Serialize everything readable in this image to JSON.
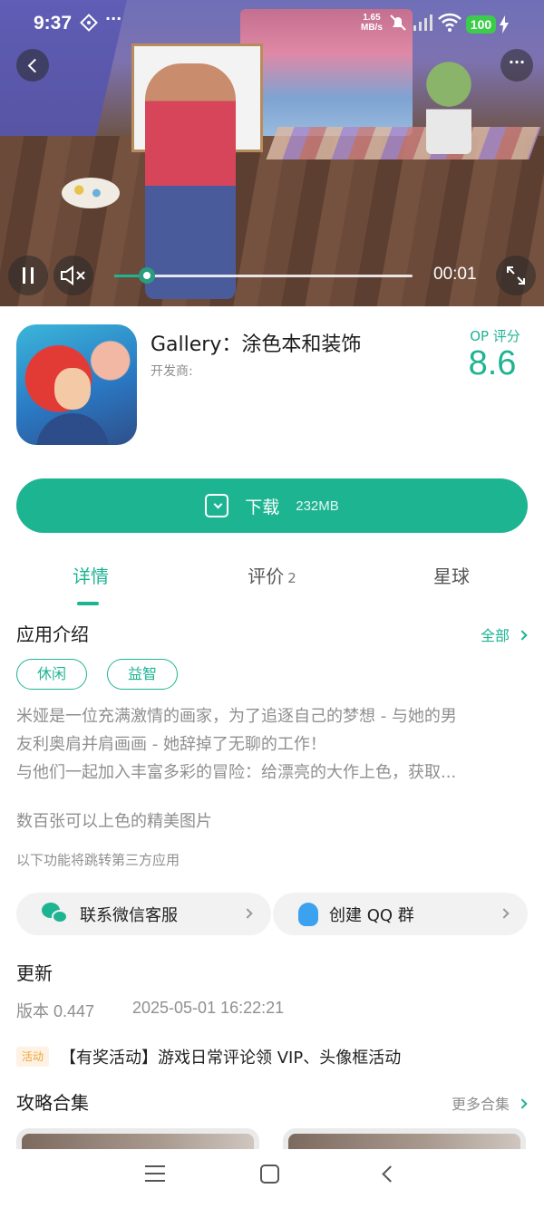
{
  "status_bar": {
    "time": "9:37",
    "more": "···",
    "net_speed_value": "1.65",
    "net_speed_unit": "MB/s",
    "battery": "100"
  },
  "video": {
    "current_time": "00:01",
    "progress": 0.11
  },
  "app": {
    "title": "Gallery：涂色本和装饰",
    "developer_label": "开发商:",
    "score_label": "OP 评分",
    "score": "8.6"
  },
  "download": {
    "label": "下载",
    "size": "232MB"
  },
  "tabs": [
    {
      "label": "详情",
      "count": ""
    },
    {
      "label": "评价",
      "count": "2"
    },
    {
      "label": "星球",
      "count": ""
    }
  ],
  "intro": {
    "title": "应用介绍",
    "all_link": "全部",
    "tags": [
      "休闲",
      "益智"
    ],
    "lines": [
      "米娅是一位充满激情的画家，为了追逐自己的梦想 - 与她的男",
      "友利奥肩并肩画画 - 她辞掉了无聊的工作！",
      "与他们一起加入丰富多彩的冒险：给漂亮的大作上色，获取..."
    ],
    "extra": "数百张可以上色的精美图片",
    "third_party_note": "以下功能将跳转第三方应用"
  },
  "services": [
    {
      "label": "联系微信客服",
      "icon": "wechat-icon"
    },
    {
      "label": "创建 QQ 群",
      "icon": "qq-icon"
    }
  ],
  "update": {
    "title": "更新",
    "version": "版本 0.447",
    "date": "2025-05-01 16:22:21"
  },
  "promo": {
    "badge": "活动",
    "text": "【有奖活动】游戏日常评论领 VIP、头像框活动"
  },
  "guides": {
    "title": "攻略合集",
    "more_link": "更多合集"
  },
  "colors": {
    "accent": "#1db492",
    "battery": "#3ccb4a",
    "promo_badge": "#f0a43a"
  }
}
